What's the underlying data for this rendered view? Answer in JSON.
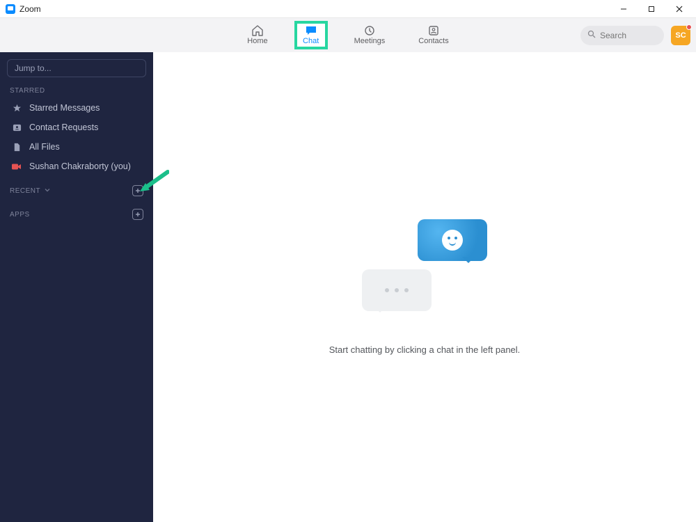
{
  "window": {
    "title": "Zoom"
  },
  "nav": {
    "tabs": [
      {
        "id": "home",
        "label": "Home"
      },
      {
        "id": "chat",
        "label": "Chat"
      },
      {
        "id": "meetings",
        "label": "Meetings"
      },
      {
        "id": "contacts",
        "label": "Contacts"
      }
    ],
    "active": "chat"
  },
  "search": {
    "placeholder": "Search"
  },
  "avatar": {
    "initials": "SC",
    "status": "dnd"
  },
  "sidebar": {
    "jump_placeholder": "Jump to...",
    "sections": {
      "starred_label": "STARRED",
      "recent_label": "RECENT",
      "apps_label": "APPS"
    },
    "starred_items": [
      {
        "id": "starred-messages",
        "label": "Starred Messages",
        "icon": "star-icon"
      },
      {
        "id": "contact-requests",
        "label": "Contact Requests",
        "icon": "person-card-icon"
      },
      {
        "id": "all-files",
        "label": "All Files",
        "icon": "file-icon"
      },
      {
        "id": "self",
        "label": "Sushan Chakraborty (you)",
        "icon": "video-icon"
      }
    ]
  },
  "main": {
    "empty_text": "Start chatting by clicking a chat in the left panel."
  },
  "colors": {
    "sidebar_bg": "#1f2540",
    "accent": "#0b8cff",
    "highlight": "#27d6a0",
    "arrow": "#1bbf8a"
  }
}
